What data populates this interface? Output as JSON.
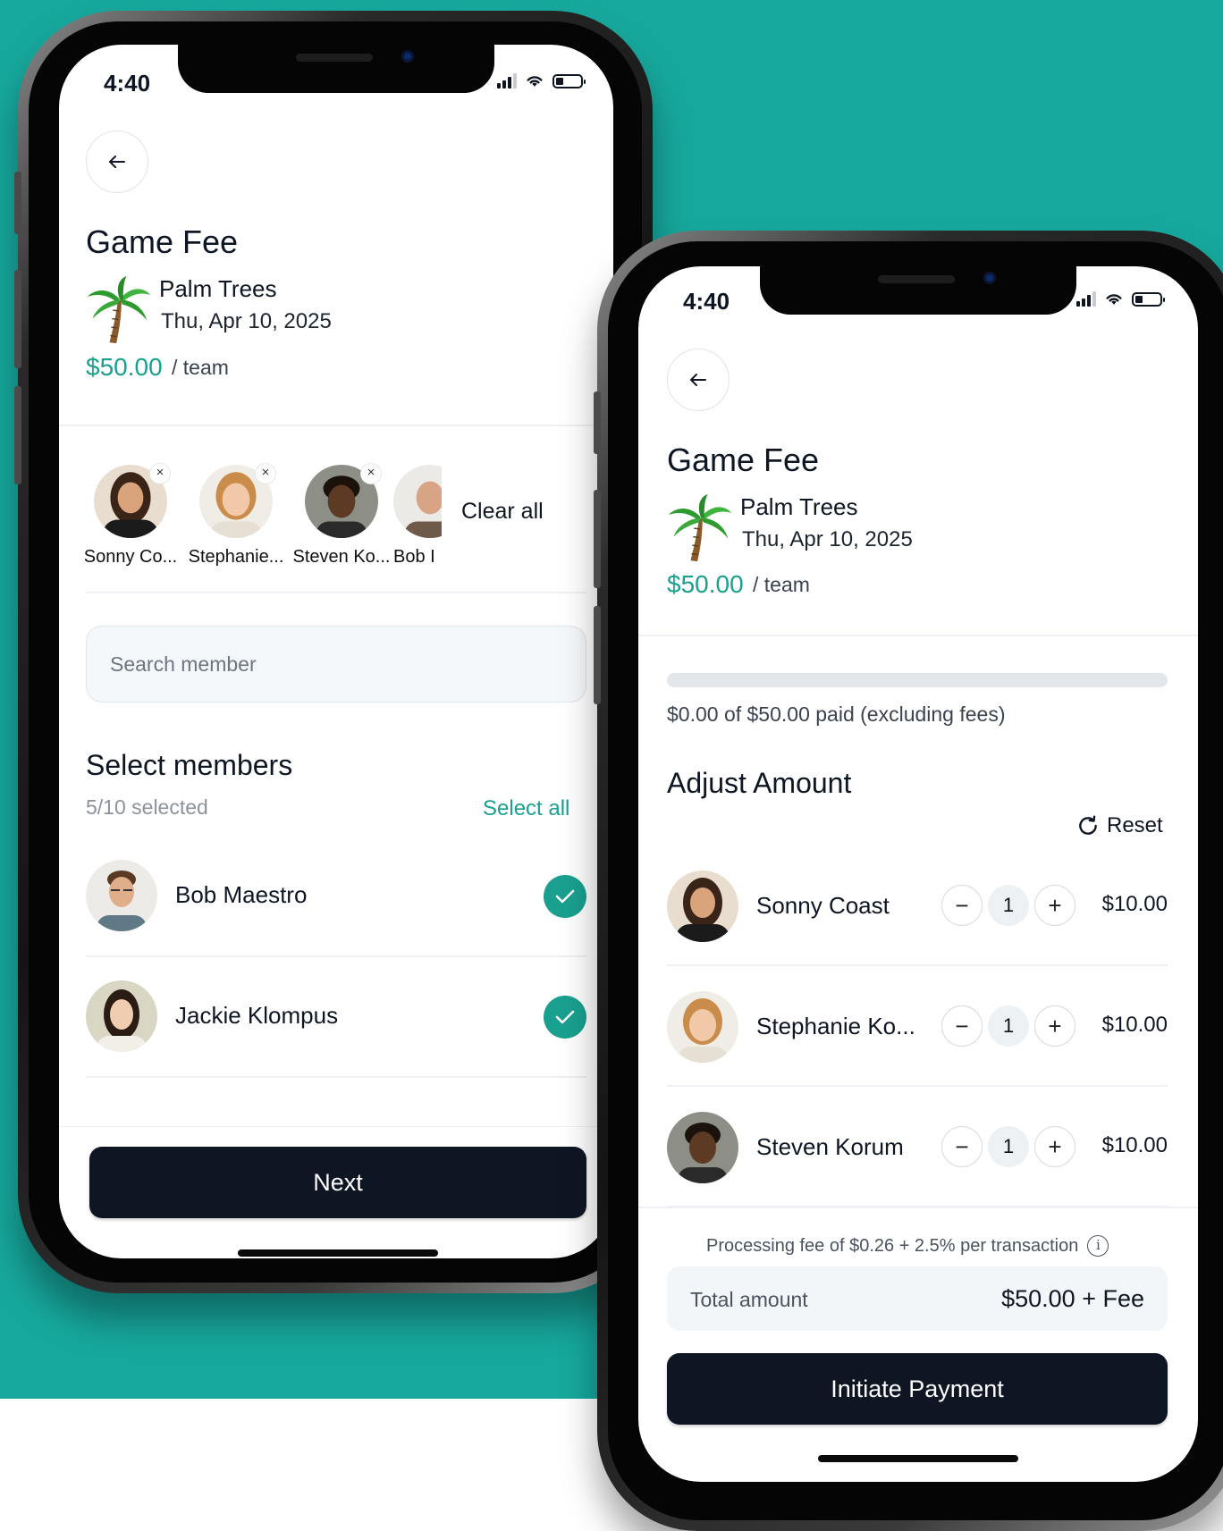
{
  "colors": {
    "background": "#17a89d",
    "accent": "#1aa08f",
    "button": "#0f1623"
  },
  "phone1": {
    "status": {
      "time": "4:40"
    },
    "title": "Game Fee",
    "event": {
      "name": "Palm Trees",
      "date": "Thu, Apr 10, 2025"
    },
    "price": {
      "amount": "$50.00",
      "unit": "/ team"
    },
    "selected_chips": [
      {
        "name": "Sonny Co..."
      },
      {
        "name": "Stephanie..."
      },
      {
        "name": "Steven Ko..."
      },
      {
        "name": "Bob I"
      }
    ],
    "clear_all": "Clear all",
    "search": {
      "placeholder": "Search member",
      "value": ""
    },
    "section_title": "Select members",
    "selected_count": "5/10 selected",
    "select_all": "Select all",
    "members": [
      {
        "name": "Bob Maestro",
        "checked": true
      },
      {
        "name": "Jackie Klompus",
        "checked": true
      }
    ],
    "next_label": "Next"
  },
  "phone2": {
    "status": {
      "time": "4:40"
    },
    "title": "Game Fee",
    "event": {
      "name": "Palm Trees",
      "date": "Thu, Apr 10, 2025"
    },
    "price": {
      "amount": "$50.00",
      "unit": "/ team"
    },
    "progress": {
      "fraction": 0.0,
      "label": "$0.00 of $50.00 paid (excluding fees)"
    },
    "section_title": "Adjust Amount",
    "reset_label": "Reset",
    "members": [
      {
        "name": "Sonny Coast",
        "qty": "1",
        "amount": "$10.00"
      },
      {
        "name": "Stephanie Ko...",
        "qty": "1",
        "amount": "$10.00"
      },
      {
        "name": "Steven Korum",
        "qty": "1",
        "amount": "$10.00"
      }
    ],
    "fee_note": "Processing fee of $0.26 + 2.5% per transaction",
    "total": {
      "label": "Total amount",
      "value": "$50.00 + Fee"
    },
    "initiate_label": "Initiate Payment"
  }
}
